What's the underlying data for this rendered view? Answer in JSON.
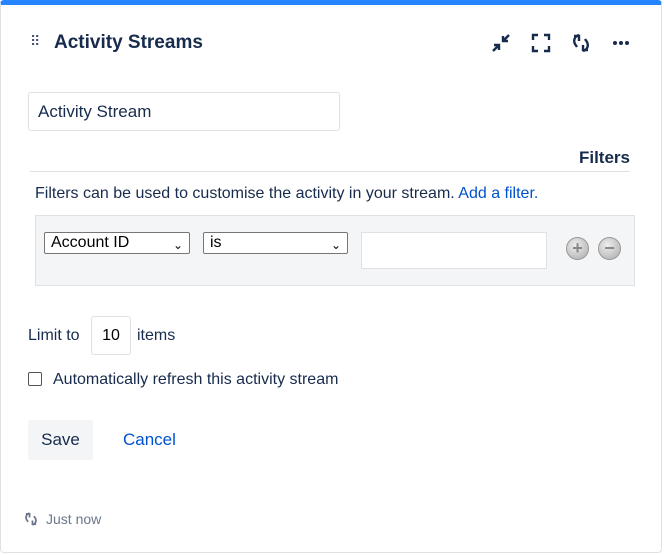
{
  "header": {
    "title": "Activity Streams",
    "icons": [
      "drag-handle-icon",
      "minimize-icon",
      "fullscreen-icon",
      "refresh-icon",
      "more-icon"
    ]
  },
  "form": {
    "title_value": "Activity Stream",
    "filters_heading": "Filters",
    "filters_description": "Filters can be used to customise the activity in your stream.",
    "add_filter_link": "Add a filter.",
    "filter_row": {
      "field": "Account ID",
      "operator": "is",
      "value": ""
    },
    "limit_prefix": "Limit to",
    "limit_value": "10",
    "limit_suffix": "items",
    "auto_refresh_label": "Automatically refresh this activity stream",
    "auto_refresh_checked": false,
    "save_label": "Save",
    "cancel_label": "Cancel"
  },
  "footer": {
    "updated": "Just now"
  },
  "colors": {
    "accent": "#2684ff",
    "link": "#0052cc"
  }
}
